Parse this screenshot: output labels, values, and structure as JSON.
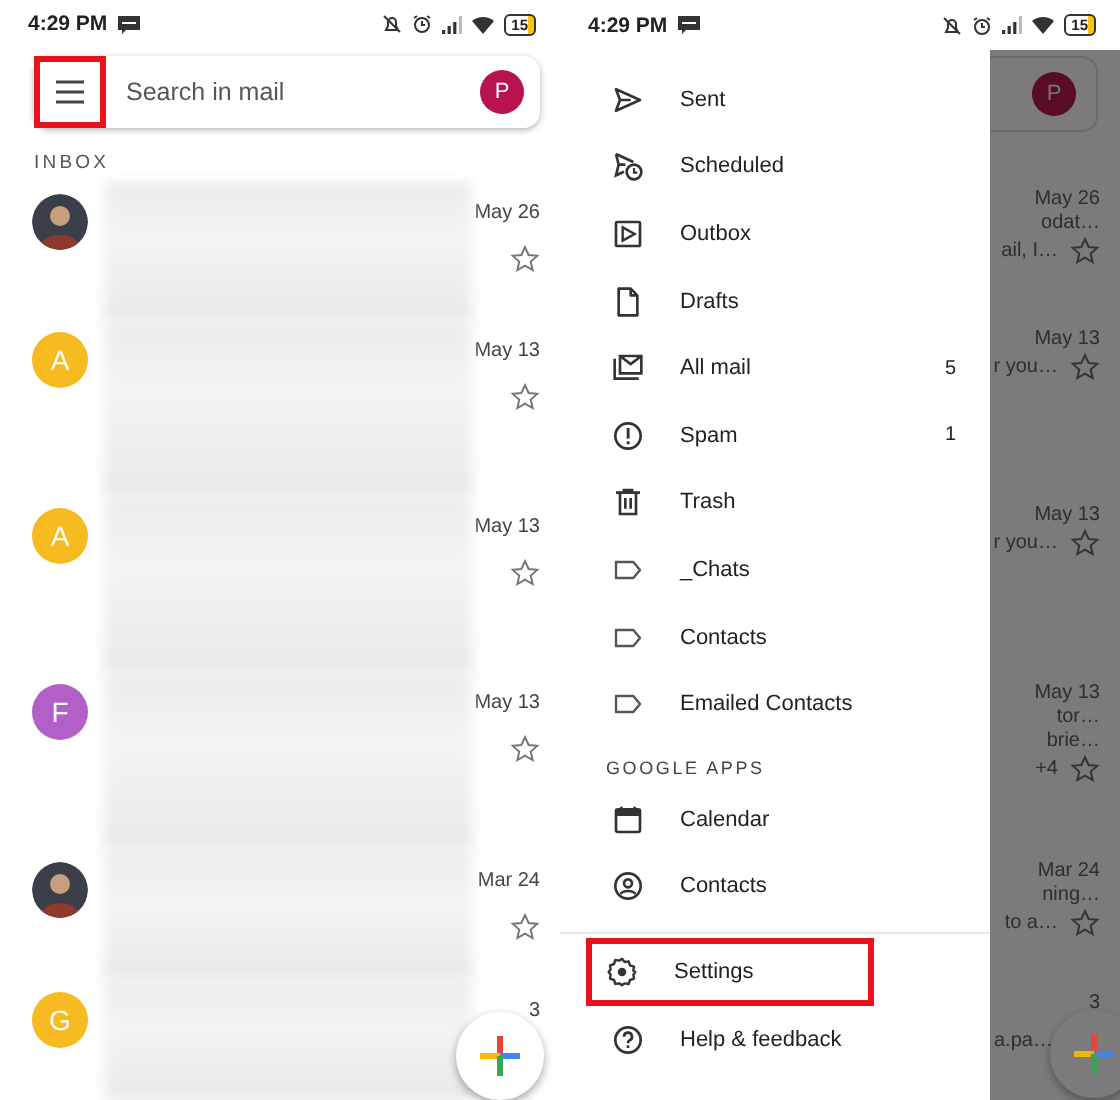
{
  "left_screen": {
    "status_bar": {
      "time": "4:29 PM",
      "battery": "15"
    },
    "search": {
      "placeholder": "Search in mail",
      "menu_highlighted": true,
      "avatar": "P"
    },
    "section_label": "INBOX",
    "rows": [
      {
        "kind": "photo",
        "date": "May 26"
      },
      {
        "kind": "letter",
        "letter": "A",
        "color": "#f6bb20",
        "date": "May 13"
      },
      {
        "kind": "letter",
        "letter": "A",
        "color": "#f6bb20",
        "date": "May 13"
      },
      {
        "kind": "letter",
        "letter": "F",
        "color": "#b25fc8",
        "date": "May 13"
      },
      {
        "kind": "photo",
        "date": "Mar 24"
      },
      {
        "kind": "letter",
        "letter": "G",
        "color": "#f6bb20",
        "date": "3"
      }
    ]
  },
  "right_screen": {
    "status_bar": {
      "time": "4:29 PM",
      "battery": "15"
    },
    "drawer": {
      "folders": [
        {
          "label": "Sent",
          "highlighted": false
        },
        {
          "label": "Scheduled",
          "highlighted": false
        },
        {
          "label": "Outbox",
          "highlighted": false
        },
        {
          "label": "Drafts",
          "highlighted": false
        },
        {
          "label": "All mail",
          "count": "5",
          "highlighted": false
        },
        {
          "label": "Spam",
          "count": "1",
          "highlighted": false
        },
        {
          "label": "Trash",
          "highlighted": false
        }
      ],
      "labels": [
        {
          "label": "_Chats",
          "highlighted": false
        },
        {
          "label": "Contacts",
          "highlighted": false
        },
        {
          "label": "Emailed Contacts",
          "highlighted": false
        }
      ],
      "apps_heading": "GOOGLE APPS",
      "apps": [
        {
          "label": "Calendar",
          "highlighted": false
        },
        {
          "label": "Contacts",
          "highlighted": false
        }
      ],
      "footer": [
        {
          "label": "Settings",
          "highlighted": true
        },
        {
          "label": "Help & feedback",
          "highlighted": false
        }
      ]
    },
    "background_inbox": {
      "avatar": "P",
      "rows": [
        {
          "date": "May 26",
          "snippets": [
            "odat…",
            "ail, I…"
          ]
        },
        {
          "date": "May 13",
          "snippets": [
            "r you…"
          ]
        },
        {
          "date": "May 13",
          "snippets": [
            "r you…"
          ]
        },
        {
          "date": "May 13",
          "snippets": [
            "tor…",
            "brie…",
            "+4"
          ]
        },
        {
          "date": "Mar 24",
          "snippets": [
            "ning…",
            "to a…"
          ]
        },
        {
          "date": "3",
          "snippets": [
            "a.pa…"
          ]
        }
      ]
    }
  }
}
